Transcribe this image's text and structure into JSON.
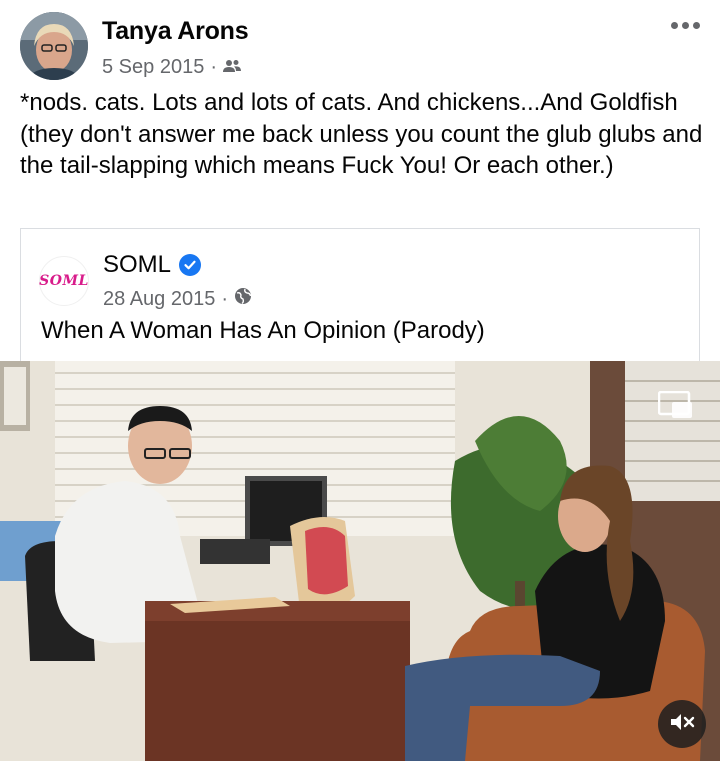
{
  "post": {
    "author": "Tanya Arons",
    "date": "5 Sep 2015",
    "separator": "·",
    "audience_icon": "friends-icon",
    "text": "*nods. cats. Lots and lots of cats.  And chickens...And Goldfish (they don't answer me back unless you count the glub glubs and the tail-slapping which means Fuck You! Or each other.)"
  },
  "shared": {
    "page_name": "SOML",
    "avatar_text": "SOML",
    "date": "28 Aug 2015",
    "separator": "·",
    "audience_icon": "globe-icon",
    "title": "When A Woman Has An Opinion (Parody)"
  },
  "video": {
    "mute_icon": "speaker-muted-icon",
    "pip_icon": "picture-in-picture-icon"
  },
  "colors": {
    "text": "#050505",
    "secondary": "#65676b",
    "verified": "#1877f2",
    "border": "#dadde1"
  }
}
